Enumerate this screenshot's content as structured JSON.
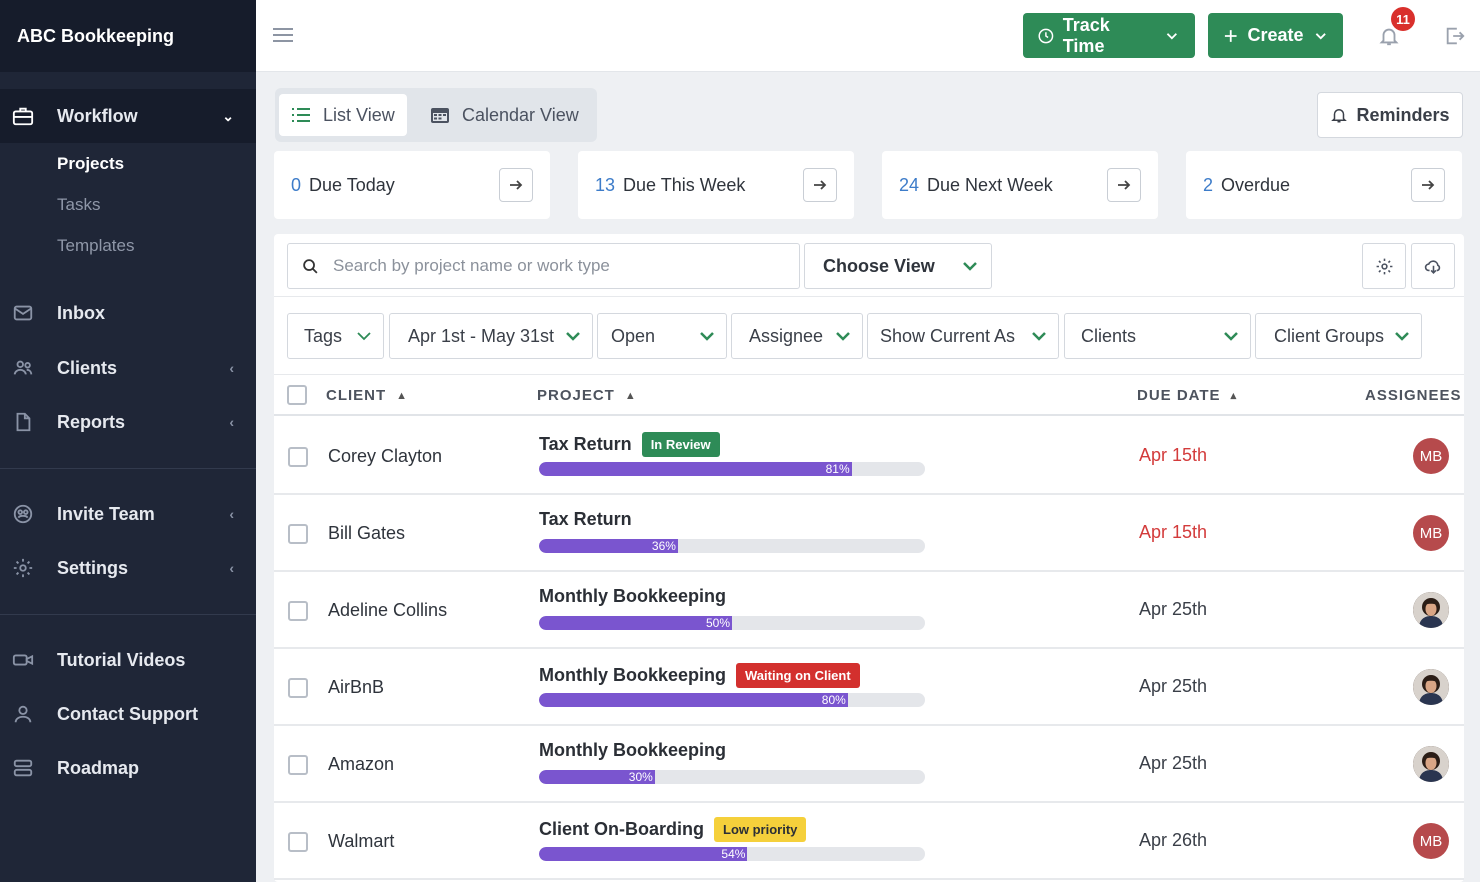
{
  "app": {
    "brand": "ABC Bookkeeping"
  },
  "sidebar": {
    "workflow": "Workflow",
    "sub": [
      "Projects",
      "Tasks",
      "Templates"
    ],
    "items": [
      {
        "label": "Inbox",
        "icon": "inbox-icon"
      },
      {
        "label": "Clients",
        "icon": "users-icon"
      },
      {
        "label": "Reports",
        "icon": "file-icon"
      },
      {
        "label": "Invite Team",
        "icon": "team-icon"
      },
      {
        "label": "Settings",
        "icon": "gear-icon"
      },
      {
        "label": "Tutorial Videos",
        "icon": "video-icon"
      },
      {
        "label": "Contact Support",
        "icon": "person-icon"
      },
      {
        "label": "Roadmap",
        "icon": "roadmap-icon"
      }
    ]
  },
  "topbar": {
    "track_time": "Track Time",
    "create": "Create",
    "notifications": "11"
  },
  "views": {
    "list": "List View",
    "calendar": "Calendar View",
    "reminders": "Reminders"
  },
  "stats": [
    {
      "count": "0",
      "label": "Due Today"
    },
    {
      "count": "13",
      "label": "Due This Week"
    },
    {
      "count": "24",
      "label": "Due Next Week"
    },
    {
      "count": "2",
      "label": "Overdue"
    }
  ],
  "search": {
    "placeholder": "Search by project name or work type",
    "choose_view": "Choose View"
  },
  "filters": [
    "Tags",
    "Apr 1st - May 31st",
    "Open",
    "Assignee",
    "Show Current As",
    "Clients",
    "Client Groups"
  ],
  "table": {
    "headers": {
      "client": "CLIENT",
      "project": "PROJECT",
      "due": "DUE DATE",
      "assignees": "ASSIGNEES"
    },
    "rows": [
      {
        "client": "Corey Clayton",
        "project": "Tax Return",
        "badge": "In Review",
        "badge_color": "green",
        "progress": 81,
        "progress_label": "81%",
        "due": "Apr 15th",
        "overdue": true,
        "assignee": "MB"
      },
      {
        "client": "Bill Gates",
        "project": "Tax Return",
        "badge": "",
        "badge_color": "",
        "progress": 36,
        "progress_label": "36%",
        "due": "Apr 15th",
        "overdue": true,
        "assignee": "MB"
      },
      {
        "client": "Adeline Collins",
        "project": "Monthly Bookkeeping",
        "badge": "",
        "badge_color": "",
        "progress": 50,
        "progress_label": "50%",
        "due": "Apr 25th",
        "overdue": false,
        "assignee": ""
      },
      {
        "client": "AirBnB",
        "project": "Monthly Bookkeeping",
        "badge": "Waiting on Client",
        "badge_color": "red",
        "progress": 80,
        "progress_label": "80%",
        "due": "Apr 25th",
        "overdue": false,
        "assignee": ""
      },
      {
        "client": "Amazon",
        "project": "Monthly Bookkeeping",
        "badge": "",
        "badge_color": "",
        "progress": 30,
        "progress_label": "30%",
        "due": "Apr 25th",
        "overdue": false,
        "assignee": ""
      },
      {
        "client": "Walmart",
        "project": "Client On-Boarding",
        "badge": "Low priority",
        "badge_color": "yellow",
        "progress": 54,
        "progress_label": "54%",
        "due": "Apr 26th",
        "overdue": false,
        "assignee": "MB"
      }
    ]
  },
  "colors": {
    "brand_green": "#2e8b57",
    "sidebar_bg": "#1f2637",
    "progress": "#7a55cf",
    "overdue": "#d33b3b"
  }
}
